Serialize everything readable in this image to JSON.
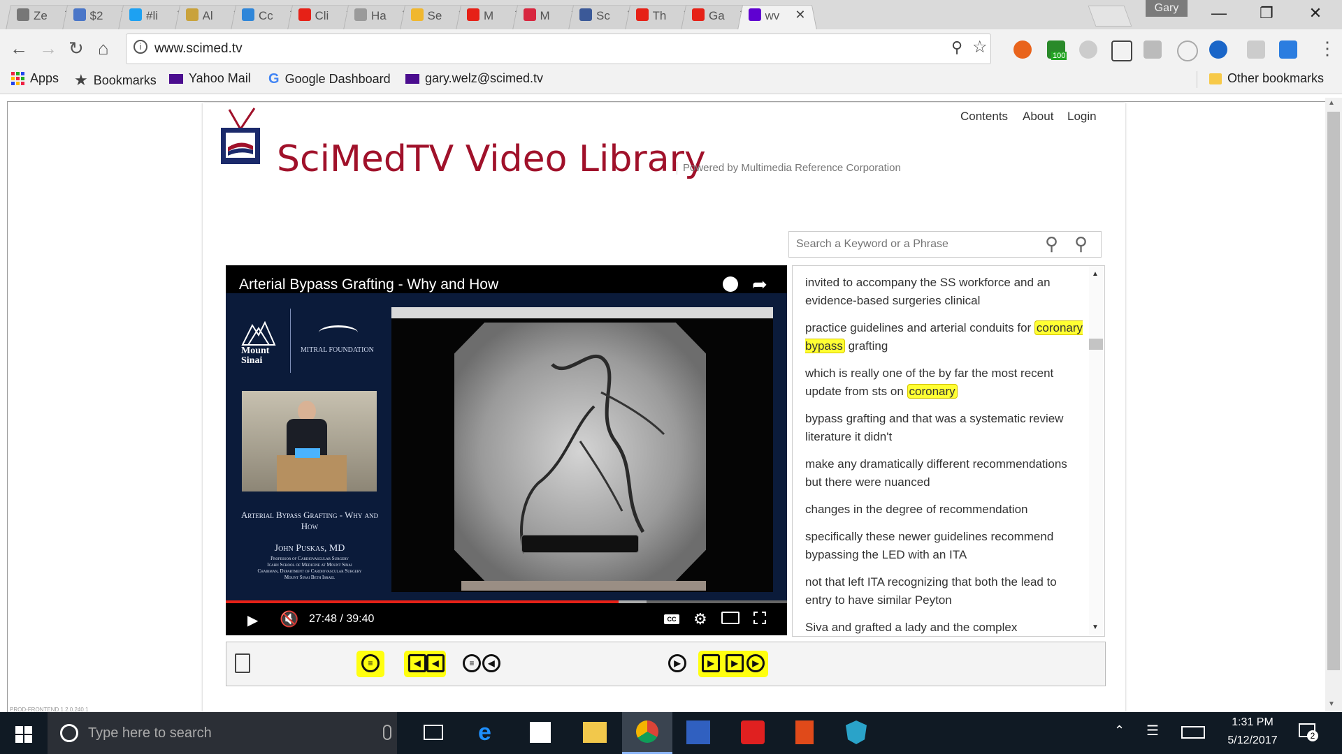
{
  "browser": {
    "tabs": [
      {
        "title": "Ze",
        "color": "#777777",
        "icon": "circle-icon"
      },
      {
        "title": "$2",
        "color": "#4a76c8",
        "icon": "bars-icon"
      },
      {
        "title": "#li",
        "color": "#1da1f2",
        "icon": "twitter-icon"
      },
      {
        "title": "Al",
        "color": "#c9a23b",
        "icon": "lines-icon"
      },
      {
        "title": "Cc",
        "color": "#2f86d9",
        "icon": "c-icon"
      },
      {
        "title": "Cli",
        "color": "#e62117",
        "icon": "youtube-icon"
      },
      {
        "title": "Ha",
        "color": "#9a9a9a",
        "icon": "page-icon"
      },
      {
        "title": "Se",
        "color": "#f0b72f",
        "icon": "b-icon"
      },
      {
        "title": "M",
        "color": "#e62117",
        "icon": "youtube-icon"
      },
      {
        "title": "M",
        "color": "#d8263f",
        "icon": "cross-icon"
      },
      {
        "title": "Sc",
        "color": "#3b5998",
        "icon": "facebook-icon"
      },
      {
        "title": "Th",
        "color": "#e62117",
        "icon": "youtube-icon"
      },
      {
        "title": "Ga",
        "color": "#e62117",
        "icon": "youtube-icon"
      },
      {
        "title": "wv",
        "color": "#5f01d1",
        "icon": "yahoo-icon"
      }
    ],
    "profile": "Gary",
    "url": "www.scimed.tv",
    "ext_badge": "100",
    "bookmarks": [
      "Apps",
      "Bookmarks",
      "Yahoo Mail",
      "Google Dashboard",
      "gary.welz@scimed.tv"
    ],
    "other_bookmarks": "Other bookmarks"
  },
  "site": {
    "nav": [
      "Contents",
      "About",
      "Login"
    ],
    "title": "SciMedTV Video Library",
    "powered": "Powered by Multimedia Reference Corporation",
    "search_placeholder": "Search a Keyword or a Phrase"
  },
  "video": {
    "title": "Arterial Bypass Grafting - Why and How",
    "time": "27:48 / 39:40",
    "progress": 0.7,
    "buffered": 0.75,
    "institution": "Mount Sinai",
    "foundation": "MITRAL FOUNDATION",
    "slide_title": "Arterial Bypass Grafting - Why and How",
    "speaker": "John Puskas, MD",
    "speaker_lines": [
      "Professor of Cardiovascular Surgery",
      "Icahn School of Medicine at Mount Sinai",
      "Chairman, Department of Cardiovascular Surgery",
      "Mount Sinai Beth Israel"
    ]
  },
  "transcript": [
    {
      "pre": "invited to accompany the SS workforce and an evidence-based surgeries clinical",
      "hl": "",
      "post": ""
    },
    {
      "pre": "practice guidelines and arterial conduits for ",
      "hl": "coronary bypass",
      "post": " grafting"
    },
    {
      "pre": "which is really one of the by far the most recent update from sts on ",
      "hl": "coronary",
      "post": ""
    },
    {
      "pre": "bypass grafting and that was a systematic review literature it didn't",
      "hl": "",
      "post": ""
    },
    {
      "pre": "make any dramatically different recommendations but there were nuanced",
      "hl": "",
      "post": ""
    },
    {
      "pre": "changes in the degree of recommendation",
      "hl": "",
      "post": ""
    },
    {
      "pre": "specifically these newer guidelines recommend bypassing the LED with an ITA",
      "hl": "",
      "post": ""
    },
    {
      "pre": "not that left ITA recognizing that both the lead to entry to have similar Peyton",
      "hl": "",
      "post": ""
    },
    {
      "pre": "Siva and grafted a lady and the complex",
      "hl": "",
      "post": ""
    }
  ],
  "footer_text": "PROD-FRONTEND 1.2.0.240.1",
  "taskbar": {
    "search_placeholder": "Type here to search",
    "time": "1:31 PM",
    "date": "5/12/2017",
    "notifications": "2"
  }
}
